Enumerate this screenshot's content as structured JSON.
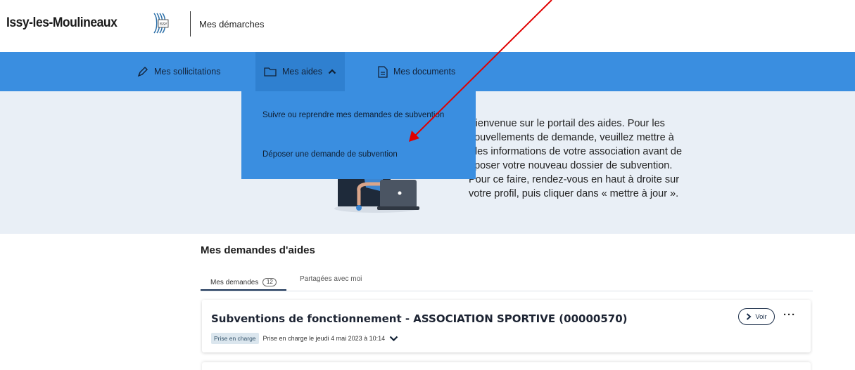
{
  "header": {
    "brand": "Issy-les-Moulineaux",
    "logo_text": "ISSY",
    "site_name": "Mes démarches"
  },
  "nav": {
    "items": [
      {
        "label": "Mes sollicitations",
        "icon": "pen-icon"
      },
      {
        "label": "Mes aides",
        "icon": "folder-icon",
        "expanded": true
      },
      {
        "label": "Mes documents",
        "icon": "document-icon"
      }
    ]
  },
  "dropdown": {
    "items": [
      "Suivre ou reprendre mes demandes de subvention",
      "Déposer une demande de subvention"
    ]
  },
  "hero": {
    "lines": [
      "Bienvenue sur le portail des aides. Pour les",
      "nouvellements de demande, veuillez mettre à",
      "r les informations de votre association avant de",
      "époser votre nouveau dossier de subvention.",
      "Pour ce faire, rendez-vous en haut à droite sur",
      "votre profil, puis cliquer dans « mettre à jour »."
    ]
  },
  "requests": {
    "section_title": "Mes demandes d'aides",
    "tabs": [
      {
        "label": "Mes demandes",
        "count": "12"
      },
      {
        "label": "Partagées avec moi"
      }
    ],
    "cards": [
      {
        "title": "Subventions de fonctionnement - ASSOCIATION SPORTIVE (00000570)",
        "status": "Prise en charge",
        "status_detail": "Prise en charge le jeudi 4 mai 2023 à 10:14",
        "view_label": "Voir",
        "more_label": "···"
      }
    ]
  },
  "colors": {
    "nav_blue": "#3a8ee0",
    "hero_bg": "#e9eff6",
    "annotation_arrow": "#e00000"
  }
}
